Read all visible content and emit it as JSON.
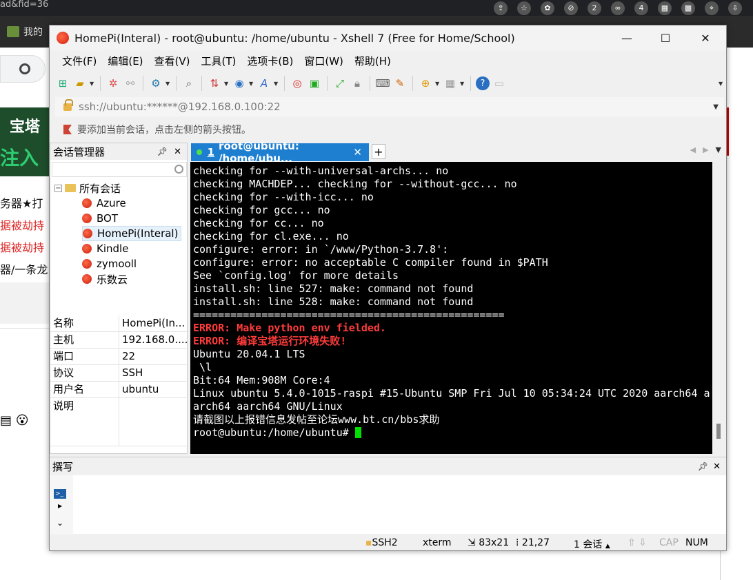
{
  "browser": {
    "url_fragment": "ad&fid=36",
    "bookmark_text": "我的",
    "ext_badge_1": "2",
    "ext_badge_2": "4",
    "banner_line1": "宝塔",
    "banner_line2": "注入",
    "bg_lines": [
      "务器★打",
      "据被劫持",
      "据被劫持",
      "器/一条龙"
    ]
  },
  "window": {
    "title": "HomePi(Interal) - root@ubuntu: /home/ubuntu - Xshell 7 (Free for Home/School)",
    "minimize": "—",
    "maximize": "☐",
    "close": "✕"
  },
  "menu": [
    "文件(F)",
    "编辑(E)",
    "查看(V)",
    "工具(T)",
    "选项卡(B)",
    "窗口(W)",
    "帮助(H)"
  ],
  "address": "ssh://ubuntu:******@192.168.0.100:22",
  "hint": "要添加当前会话，点击左侧的箭头按钮。",
  "session_manager": {
    "title": "会话管理器",
    "root": "所有会话",
    "sessions": [
      "Azure",
      "BOT",
      "HomePi(Interal)",
      "Kindle",
      "zymooll",
      "乐数云"
    ],
    "selected_index": 2
  },
  "properties": [
    {
      "key": "名称",
      "value": "HomePi(In..."
    },
    {
      "key": "主机",
      "value": "192.168.0...."
    },
    {
      "key": "端口",
      "value": "22"
    },
    {
      "key": "协议",
      "value": "SSH"
    },
    {
      "key": "用户名",
      "value": "ubuntu"
    },
    {
      "key": "说明",
      "value": ""
    }
  ],
  "tab": {
    "number": "1",
    "label": "root@ubuntu: /home/ubu...",
    "close": "✕",
    "add": "+"
  },
  "terminal": {
    "lines": [
      {
        "text": "checking for --with-universal-archs... no",
        "style": "normal"
      },
      {
        "text": "checking MACHDEP... checking for --without-gcc... no",
        "style": "normal"
      },
      {
        "text": "checking for --with-icc... no",
        "style": "normal"
      },
      {
        "text": "checking for gcc... no",
        "style": "normal"
      },
      {
        "text": "checking for cc... no",
        "style": "normal"
      },
      {
        "text": "checking for cl.exe... no",
        "style": "normal"
      },
      {
        "text": "configure: error: in `/www/Python-3.7.8':",
        "style": "normal"
      },
      {
        "text": "configure: error: no acceptable C compiler found in $PATH",
        "style": "normal"
      },
      {
        "text": "See `config.log' for more details",
        "style": "normal"
      },
      {
        "text": "install.sh: line 527: make: command not found",
        "style": "normal"
      },
      {
        "text": "install.sh: line 528: make: command not found",
        "style": "normal"
      },
      {
        "text": "==================================================",
        "style": "normal"
      },
      {
        "text": "ERROR: Make python env fielded.",
        "style": "err"
      },
      {
        "text": "ERROR: 编译宝塔运行环境失败!",
        "style": "err"
      },
      {
        "text": "Ubuntu 20.04.1 LTS",
        "style": "normal"
      },
      {
        "text": " \\l",
        "style": "normal"
      },
      {
        "text": "Bit:64 Mem:908M Core:4",
        "style": "normal"
      },
      {
        "text": "Linux ubuntu 5.4.0-1015-raspi #15-Ubuntu SMP Fri Jul 10 05:34:24 UTC 2020 aarch64 a",
        "style": "normal"
      },
      {
        "text": "arch64 aarch64 GNU/Linux",
        "style": "normal"
      },
      {
        "text": "请截图以上报错信息发帖至论坛www.bt.cn/bbs求助",
        "style": "normal"
      }
    ],
    "prompt": "root@ubuntu:/home/ubuntu# ",
    "error_color": "#ff3b3b",
    "cursor_color": "#00e000"
  },
  "compose": {
    "title": "撰写"
  },
  "status": {
    "protocol": "SSH2",
    "term": "xterm",
    "size": "83x21",
    "cursor_pos": "21,27",
    "sessions": "1 会话",
    "cap": "CAP",
    "num": "NUM"
  }
}
